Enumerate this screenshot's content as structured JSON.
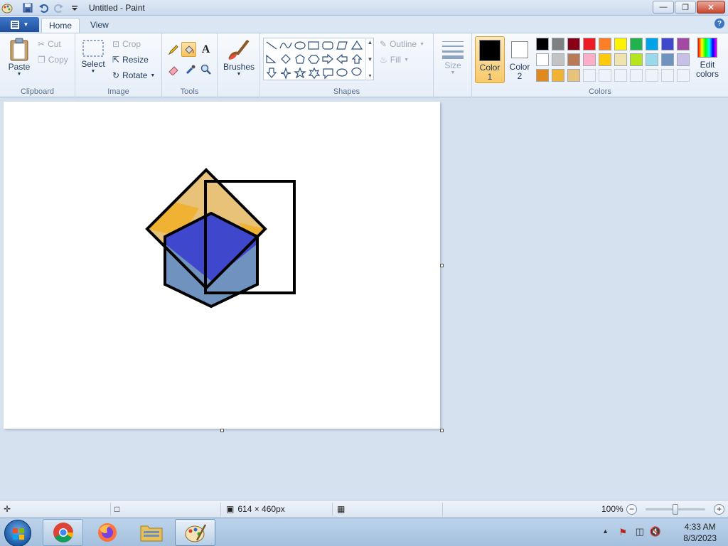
{
  "window": {
    "title": "Untitled - Paint",
    "controls": [
      "minimize",
      "maximize",
      "close"
    ]
  },
  "tabs": [
    {
      "label": "Home",
      "active": true
    },
    {
      "label": "View",
      "active": false
    }
  ],
  "ribbon": {
    "clipboard": {
      "label": "Clipboard",
      "paste": "Paste",
      "cut": "Cut",
      "copy": "Copy"
    },
    "image": {
      "label": "Image",
      "select": "Select",
      "crop": "Crop",
      "resize": "Resize",
      "rotate": "Rotate"
    },
    "tools": {
      "label": "Tools",
      "selected": "fill-tool"
    },
    "brushes": {
      "label": "Brushes"
    },
    "shapes": {
      "label": "Shapes",
      "outline": "Outline",
      "fill": "Fill"
    },
    "size": {
      "label": "Size"
    },
    "colors": {
      "label": "Colors",
      "color1_label": "Color",
      "color1_num": "1",
      "color2_label": "Color",
      "color2_num": "2",
      "color1": "#000000",
      "color2": "#ffffff",
      "edit_colors_line1": "Edit",
      "edit_colors_line2": "colors",
      "palette": [
        [
          "#000000",
          "#7f7f7f",
          "#880015",
          "#ed1c24",
          "#ff7f27",
          "#fff200",
          "#22b14c",
          "#00a2e8",
          "#3f48cc",
          "#a349a4"
        ],
        [
          "#ffffff",
          "#c3c3c3",
          "#b97a57",
          "#ffaec9",
          "#ffc90e",
          "#efe4b0",
          "#b5e61d",
          "#99d9ea",
          "#7092be",
          "#c8bfe7"
        ],
        [
          "#e08a1e",
          "#f0b232",
          "#e6c27a",
          "",
          "",
          "",
          "",
          "",
          "",
          ""
        ]
      ]
    }
  },
  "canvas": {
    "background": "#ffffff",
    "shape_colors": {
      "diamond_fill": "#e9c27a",
      "diamond_accent": "#f0b232",
      "hexagon_top": "#3f48cc",
      "hexagon_bottom": "#7092be",
      "stroke": "#000000"
    }
  },
  "statusbar": {
    "dimensions": "614 × 460px",
    "zoom": "100%"
  },
  "taskbar": {
    "apps": [
      "chrome-icon",
      "firefox-icon",
      "file-explorer-icon",
      "paint-icon"
    ],
    "time": "4:33 AM",
    "date": "8/3/2023"
  }
}
